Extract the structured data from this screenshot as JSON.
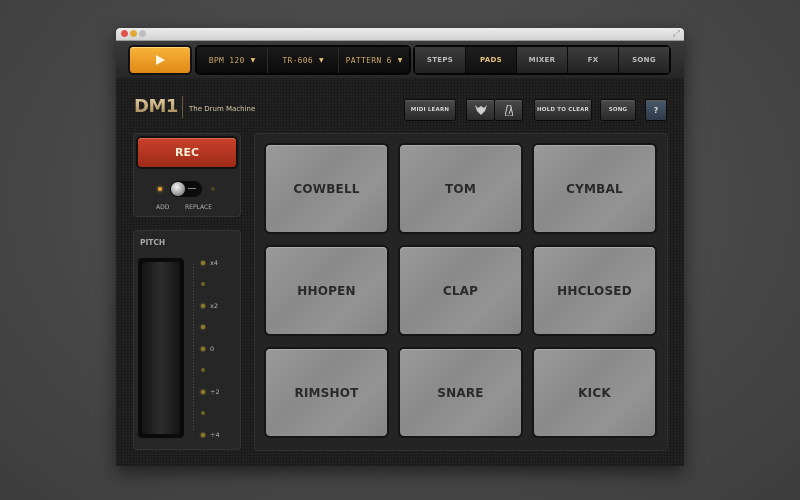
{
  "window": {
    "controls": [
      "close",
      "minimize",
      "zoom"
    ],
    "fullscreen_icon": "fullscreen-arrows-icon"
  },
  "transport": {
    "play_icon": "play-icon",
    "bpm": "BPM 120",
    "kit": "TR-606",
    "pattern": "PATTERN 6"
  },
  "tabs": [
    {
      "label": "STEPS",
      "active": false
    },
    {
      "label": "PADS",
      "active": true
    },
    {
      "label": "MIXER",
      "active": false
    },
    {
      "label": "FX",
      "active": false
    },
    {
      "label": "SONG",
      "active": false
    }
  ],
  "header": {
    "logo": "DM1",
    "subtitle": "The Drum Machine",
    "buttons": {
      "midi_learn": "MIDI LEARN",
      "icon1": "audiobus-icon",
      "icon2": "metronome-icon",
      "hold_to_clear": "HOLD TO CLEAR",
      "song": "SONG",
      "help": "?"
    }
  },
  "rec_panel": {
    "rec_label": "REC",
    "mode_add": "ADD",
    "mode_replace": "REPLACE",
    "selected_mode": "ADD"
  },
  "pitch_panel": {
    "label": "PITCH",
    "marks": [
      "x4",
      "",
      "x2",
      "",
      "0",
      "",
      "÷2",
      "",
      "÷4"
    ]
  },
  "pads": [
    "COWBELL",
    "TOM",
    "CYMBAL",
    "HHOPEN",
    "CLAP",
    "HHCLOSED",
    "RIMSHOT",
    "SNARE",
    "KICK"
  ],
  "colors": {
    "accent_orange": "#f0a030",
    "rec_red": "#b8361f",
    "lcd_text": "#c9a86a",
    "active_tab": "#e5c27a"
  }
}
